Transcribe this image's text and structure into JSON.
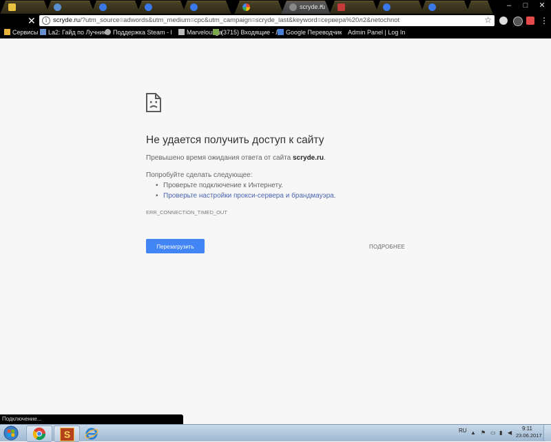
{
  "browser": {
    "active_tab_title": "scryde.ru",
    "url_host": "scryde.ru",
    "url_rest": "/?utm_source=adwords&utm_medium=cpc&utm_campaign=scryde_last&keyword=сервера%20л2&netochnot",
    "star_icon": "star-icon",
    "minimize": "–",
    "maximize": "□",
    "close": "✕"
  },
  "bookmarks": [
    {
      "label": "Сервисы",
      "icon": "apps-icon",
      "color": "#e8b33a"
    },
    {
      "label": "La2: Гайд по Лучник",
      "icon": "bookmark-icon",
      "color": "#6a8fd0"
    },
    {
      "label": "Поддержка Steam - l",
      "icon": "steam-icon",
      "color": "#aaaaaa"
    },
    {
      "label": "Marvelousga",
      "icon": "gamepad-icon",
      "color": "#bbbbbb"
    },
    {
      "label": "(3715) Входящие - Ли",
      "icon": "mail-icon",
      "color": "#7aa84a"
    },
    {
      "label": "Google Переводчик",
      "icon": "translate-icon",
      "color": "#4a7fd6"
    },
    {
      "label": "Admin Panel | Log In",
      "icon": "",
      "color": ""
    }
  ],
  "error_page": {
    "title": "Не удается получить доступ к сайту",
    "desc_prefix": "Превышено время ожидания ответа от сайта ",
    "desc_host": "scryde.ru",
    "desc_suffix": ".",
    "suggest_heading": "Попробуйте сделать следующее:",
    "suggestions": [
      "Проверьте подключение к Интернету.",
      "Проверьте настройки прокси-сервера и брандмауэра."
    ],
    "error_code": "ERR_CONNECTION_TIMED_OUT",
    "reload_label": "Перезагрузить",
    "details_label": "ПОДРОБНЕЕ"
  },
  "status_text": "Подключение...",
  "taskbar": {
    "lang": "RU",
    "time": "9:11",
    "date": "23.06.2017"
  },
  "colors": {
    "accent": "#4285f4",
    "link": "#4a63b3"
  }
}
